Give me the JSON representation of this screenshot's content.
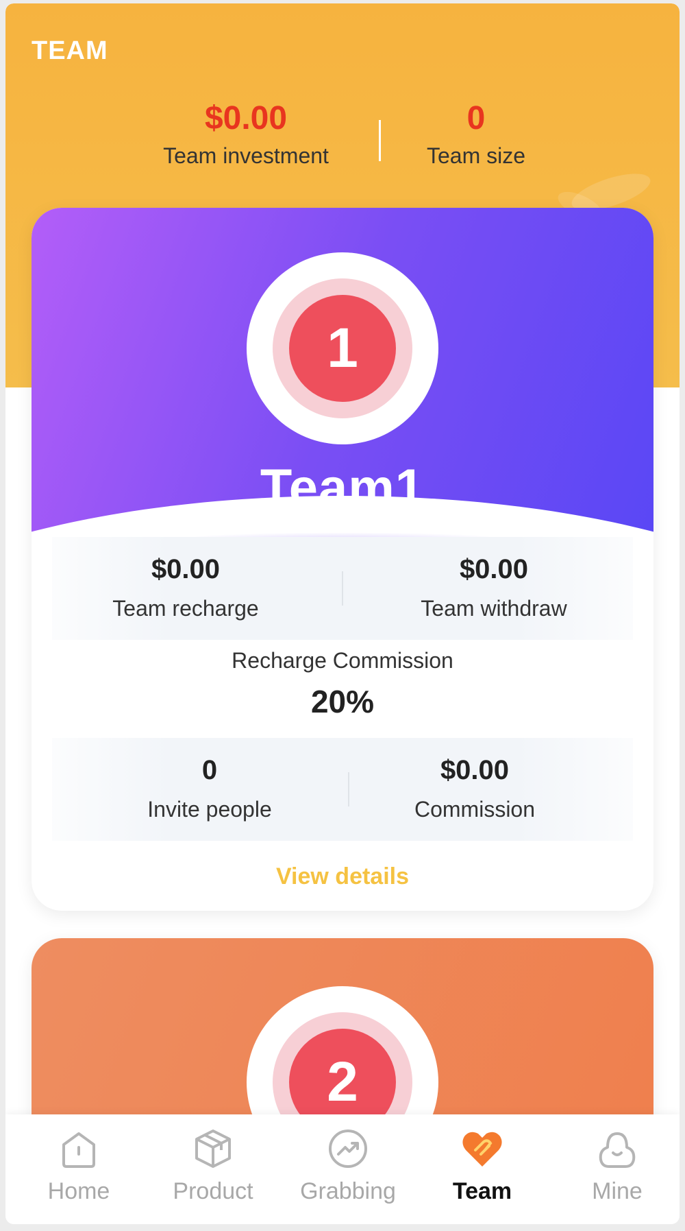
{
  "header": {
    "title": "TEAM",
    "team_investment_value": "$0.00",
    "team_investment_label": "Team investment",
    "team_size_value": "0",
    "team_size_label": "Team size"
  },
  "teams": [
    {
      "medal_number": "1",
      "name": "Team1",
      "recharge_value": "$0.00",
      "recharge_label": "Team recharge",
      "withdraw_value": "$0.00",
      "withdraw_label": "Team withdraw",
      "commission_title": "Recharge Commission",
      "commission_rate": "20%",
      "invite_value": "0",
      "invite_label": "Invite people",
      "commission_value": "$0.00",
      "commission_label": "Commission",
      "details_link": "View details",
      "gradient": [
        "#b35ef8",
        "#5a47f5"
      ]
    },
    {
      "medal_number": "2",
      "gradient": [
        "#ee8d60",
        "#ef7f4d"
      ]
    }
  ],
  "tabbar": {
    "items": [
      {
        "label": "Home",
        "icon": "home-icon"
      },
      {
        "label": "Product",
        "icon": "box-icon"
      },
      {
        "label": "Grabbing",
        "icon": "trend-icon"
      },
      {
        "label": "Team",
        "icon": "heart-handshake-icon",
        "active": true
      },
      {
        "label": "Mine",
        "icon": "user-icon"
      }
    ]
  },
  "colors": {
    "accent_red": "#e8351f",
    "header_yellow": "#f6b33f",
    "link_yellow": "#f5c242",
    "active_tab_icon": "#f47a2e"
  }
}
